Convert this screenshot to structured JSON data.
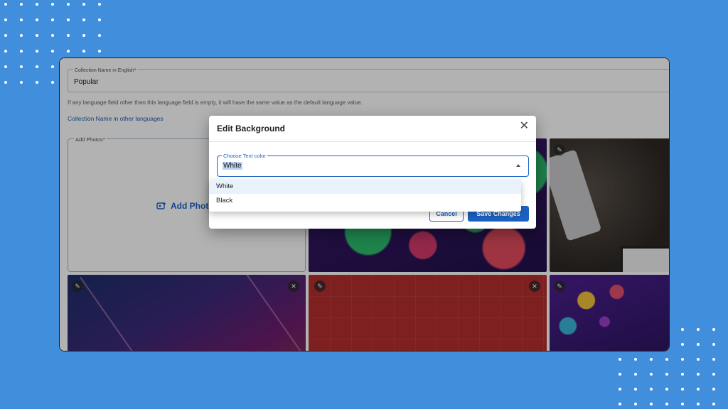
{
  "colors": {
    "page_background": "#418fdc",
    "accent": "#1b62c4",
    "selection_highlight": "#b9d3f3"
  },
  "form": {
    "collection_name_label": "Collection Name in English*",
    "collection_name_value": "Popular",
    "hint": "If any language field other than this language field is empty, it will have the same value as the default language value.",
    "other_languages_link": "Collection Name in other languages",
    "add_photos_label": "Add Photos*",
    "add_photos_action": "Add Photo"
  },
  "tiles": {
    "edit_icon": "pencil-icon",
    "remove_icon": "close-icon",
    "remove_glyph": "✕"
  },
  "modal": {
    "title": "Edit Background",
    "close_glyph": "✕",
    "select_label": "Choose Text color",
    "select_value": "White",
    "cancel_label": "Cancel",
    "save_label": "Save Changes",
    "options": [
      "White",
      "Black"
    ]
  }
}
